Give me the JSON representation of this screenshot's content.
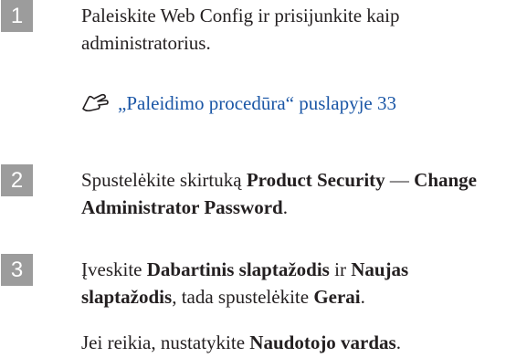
{
  "steps": [
    {
      "number": "1",
      "text": "Paleiskite Web Config ir prisijunkite kaip administratorius.",
      "link": "„Paleidimo procedūra“ puslapyje 33"
    },
    {
      "number": "2",
      "pre": "Spustelėkite skirtuką ",
      "bold1": "Product Security",
      "mid": " — ",
      "bold2": "Change Administrator Password",
      "post": "."
    },
    {
      "number": "3",
      "pre": "Įveskite ",
      "bold1": "Dabartinis slaptažodis",
      "mid": " ir ",
      "bold2": "Naujas slaptažodis",
      "mid2": ", tada spustelėkite ",
      "bold3": "Gerai",
      "post": ".",
      "note_pre": "Jei reikia, nustatykite ",
      "note_bold": "Naudotojo vardas",
      "note_post": "."
    }
  ],
  "colors": {
    "badge": "#9c9c9c",
    "link": "#1a56a6",
    "text": "#231f20"
  },
  "icons": {
    "reference": "pointing-hand-icon"
  }
}
